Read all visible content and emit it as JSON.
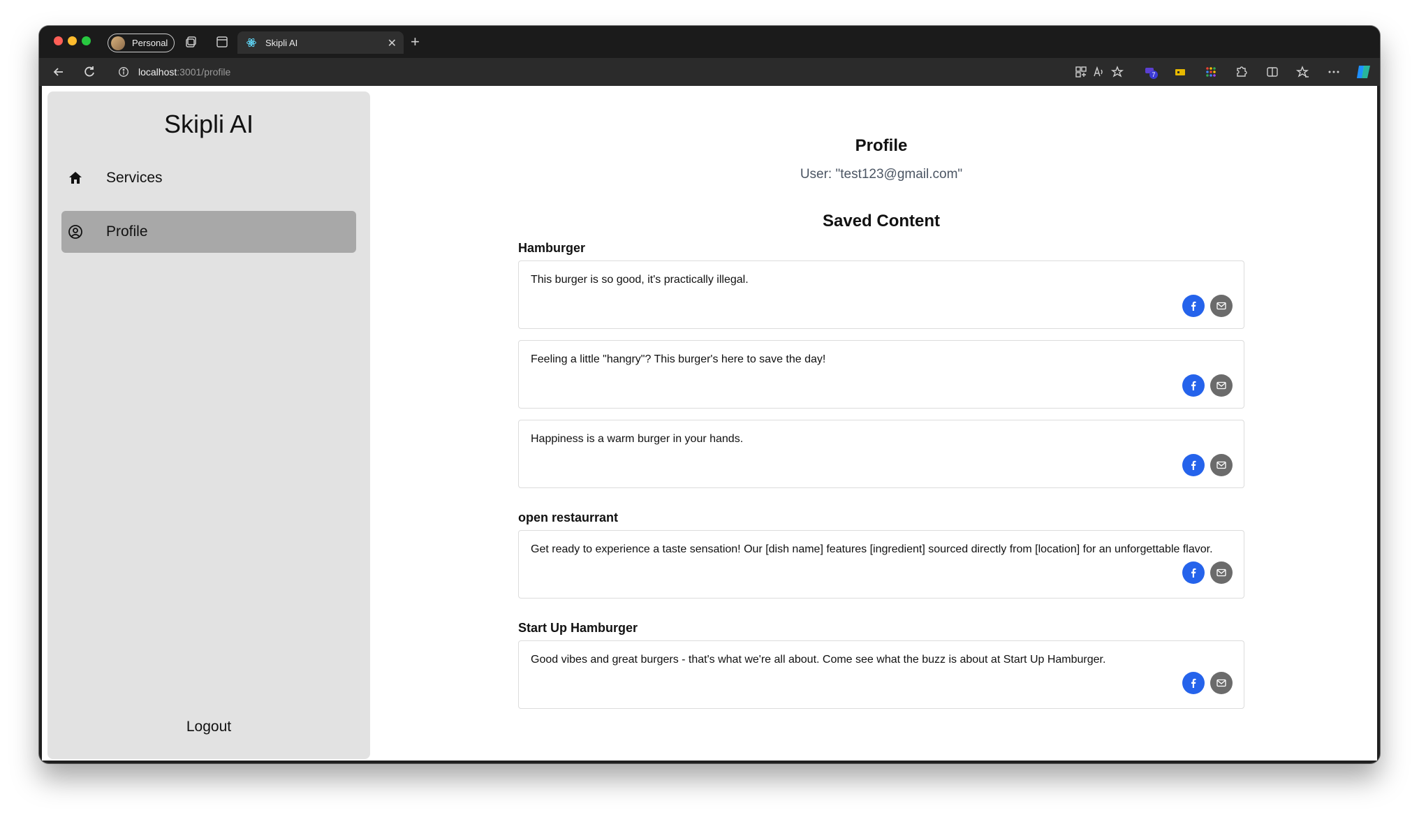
{
  "browser": {
    "profile_label": "Personal",
    "tab_title": "Skipli AI",
    "url_host": "localhost",
    "url_path": ":3001/profile",
    "extension_badge": "7"
  },
  "sidebar": {
    "brand": "Skipli AI",
    "items": [
      {
        "label": "Services",
        "icon": "home-icon"
      },
      {
        "label": "Profile",
        "icon": "user-circle-icon",
        "active": true
      }
    ],
    "logout_label": "Logout"
  },
  "main": {
    "title": "Profile",
    "user_line": "User: \"test123@gmail.com\"",
    "saved_title": "Saved Content",
    "groups": [
      {
        "title": "Hamburger",
        "items": [
          "This burger is so good, it's practically illegal.",
          "Feeling a little \"hangry\"? This burger's here to save the day!",
          "Happiness is a warm burger in your hands."
        ]
      },
      {
        "title": "open restaurrant",
        "items": [
          "Get ready to experience a taste sensation! Our [dish name] features [ingredient] sourced directly from [location] for an unforgettable flavor."
        ]
      },
      {
        "title": "Start Up Hamburger",
        "items": [
          "Good vibes and great burgers - that's what we're all about. Come see what the buzz is about at Start Up Hamburger."
        ]
      }
    ]
  },
  "colors": {
    "facebook_button": "#2563eb",
    "email_button": "#6b6b6b",
    "sidebar_bg": "#e2e2e2",
    "active_item_bg": "#a8a8a8"
  }
}
